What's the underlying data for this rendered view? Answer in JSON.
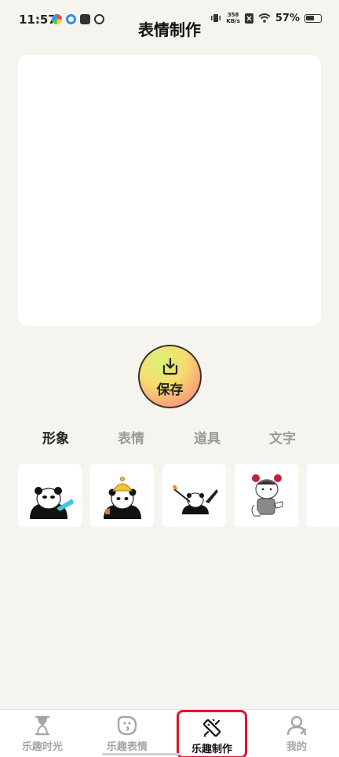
{
  "status_bar": {
    "time": "11:57",
    "speed_value": "358",
    "speed_unit": "KB/s",
    "battery_percent": "57%",
    "battery_level": 0.57
  },
  "header": {
    "title": "表情制作"
  },
  "editor": {
    "save_label": "保存"
  },
  "tabs": [
    {
      "label": "形象",
      "active": true
    },
    {
      "label": "表情",
      "active": false
    },
    {
      "label": "道具",
      "active": false
    },
    {
      "label": "文字",
      "active": false
    }
  ],
  "stickers": [
    {
      "icon": "panda-with-blue-trumpet-icon"
    },
    {
      "icon": "panda-with-yellow-hat-icon"
    },
    {
      "icon": "panda-with-torch-icon"
    },
    {
      "icon": "girl-with-pigtails-icon"
    },
    {
      "icon": "partial-sticker-icon"
    }
  ],
  "bottom_nav": [
    {
      "label": "乐趣时光",
      "icon": "hourglass-icon",
      "active": false
    },
    {
      "label": "乐趣表情",
      "icon": "smiley-face-icon",
      "active": false
    },
    {
      "label": "乐趣制作",
      "icon": "ruler-pencil-icon",
      "active": true
    },
    {
      "label": "我的",
      "icon": "profile-icon",
      "active": false
    }
  ],
  "colors": {
    "background": "#f5f4ee",
    "highlight_border": "#e0142a",
    "tab_active": "#222222",
    "tab_inactive": "#9a9a9a"
  }
}
